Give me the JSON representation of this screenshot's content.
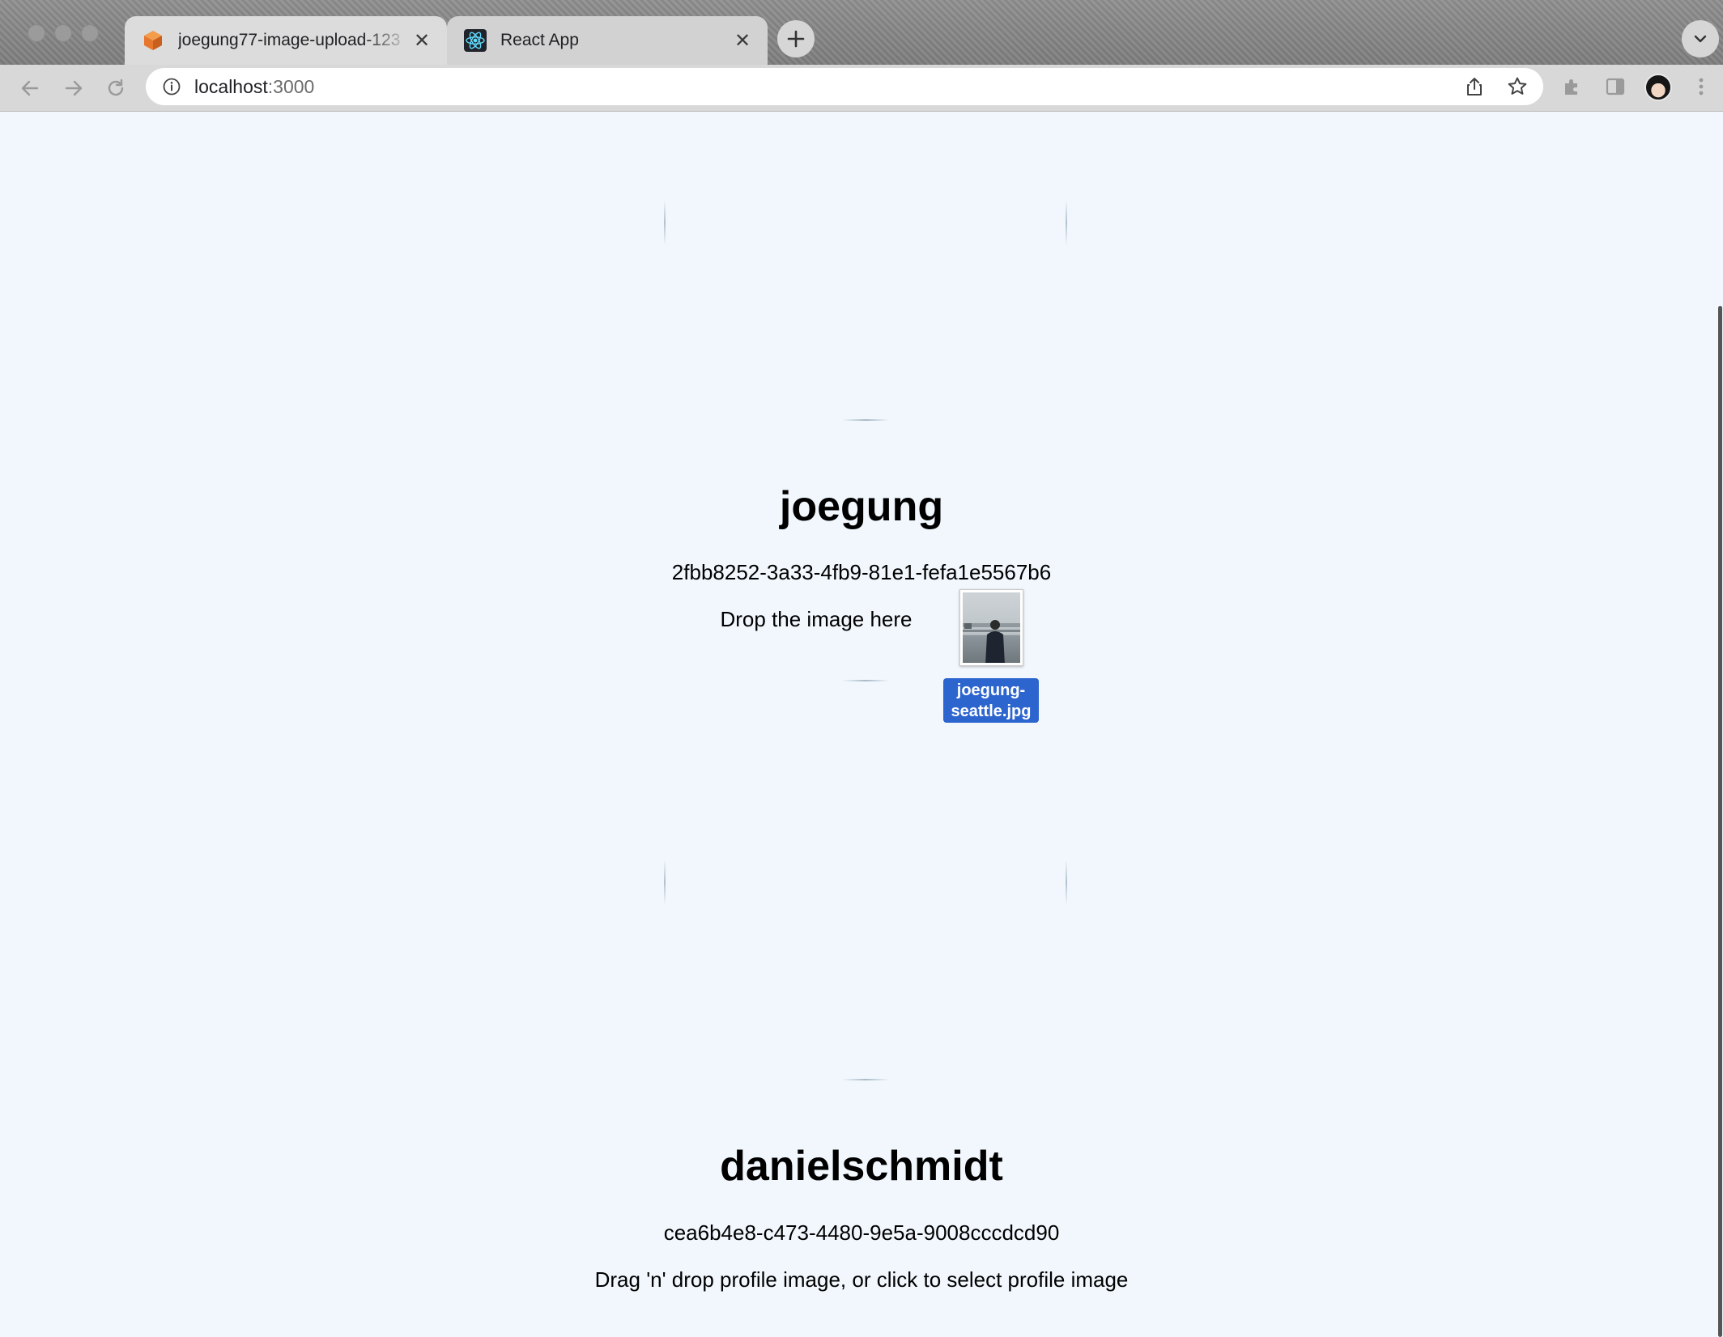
{
  "browser": {
    "tabs": [
      {
        "title": "joegung77-image-upload-123",
        "favicon": "package-cube-icon"
      },
      {
        "title": "React App",
        "favicon": "react-atom-icon"
      }
    ],
    "address": {
      "host": "localhost",
      "port": ":3000"
    }
  },
  "profiles": [
    {
      "name": "joegung",
      "id": "2fbb8252-3a33-4fb9-81e1-fefa1e5567b6",
      "dropzone_text": "Drop the image here"
    },
    {
      "name": "danielschmidt",
      "id": "cea6b4e8-c473-4480-9e5a-9008cccdcd90",
      "dropzone_text": "Drag 'n' drop profile image, or click to select profile image"
    }
  ],
  "drag_file": {
    "name": "joegung-seattle.jpg",
    "label_line1": "joegung-",
    "label_line2": "seattle.jpg"
  },
  "colors": {
    "page_background": "#f1f7fd",
    "drag_label_background": "#2d65cf",
    "tab_favicon_orange": "#e8772e",
    "react_blue": "#61dafb"
  }
}
